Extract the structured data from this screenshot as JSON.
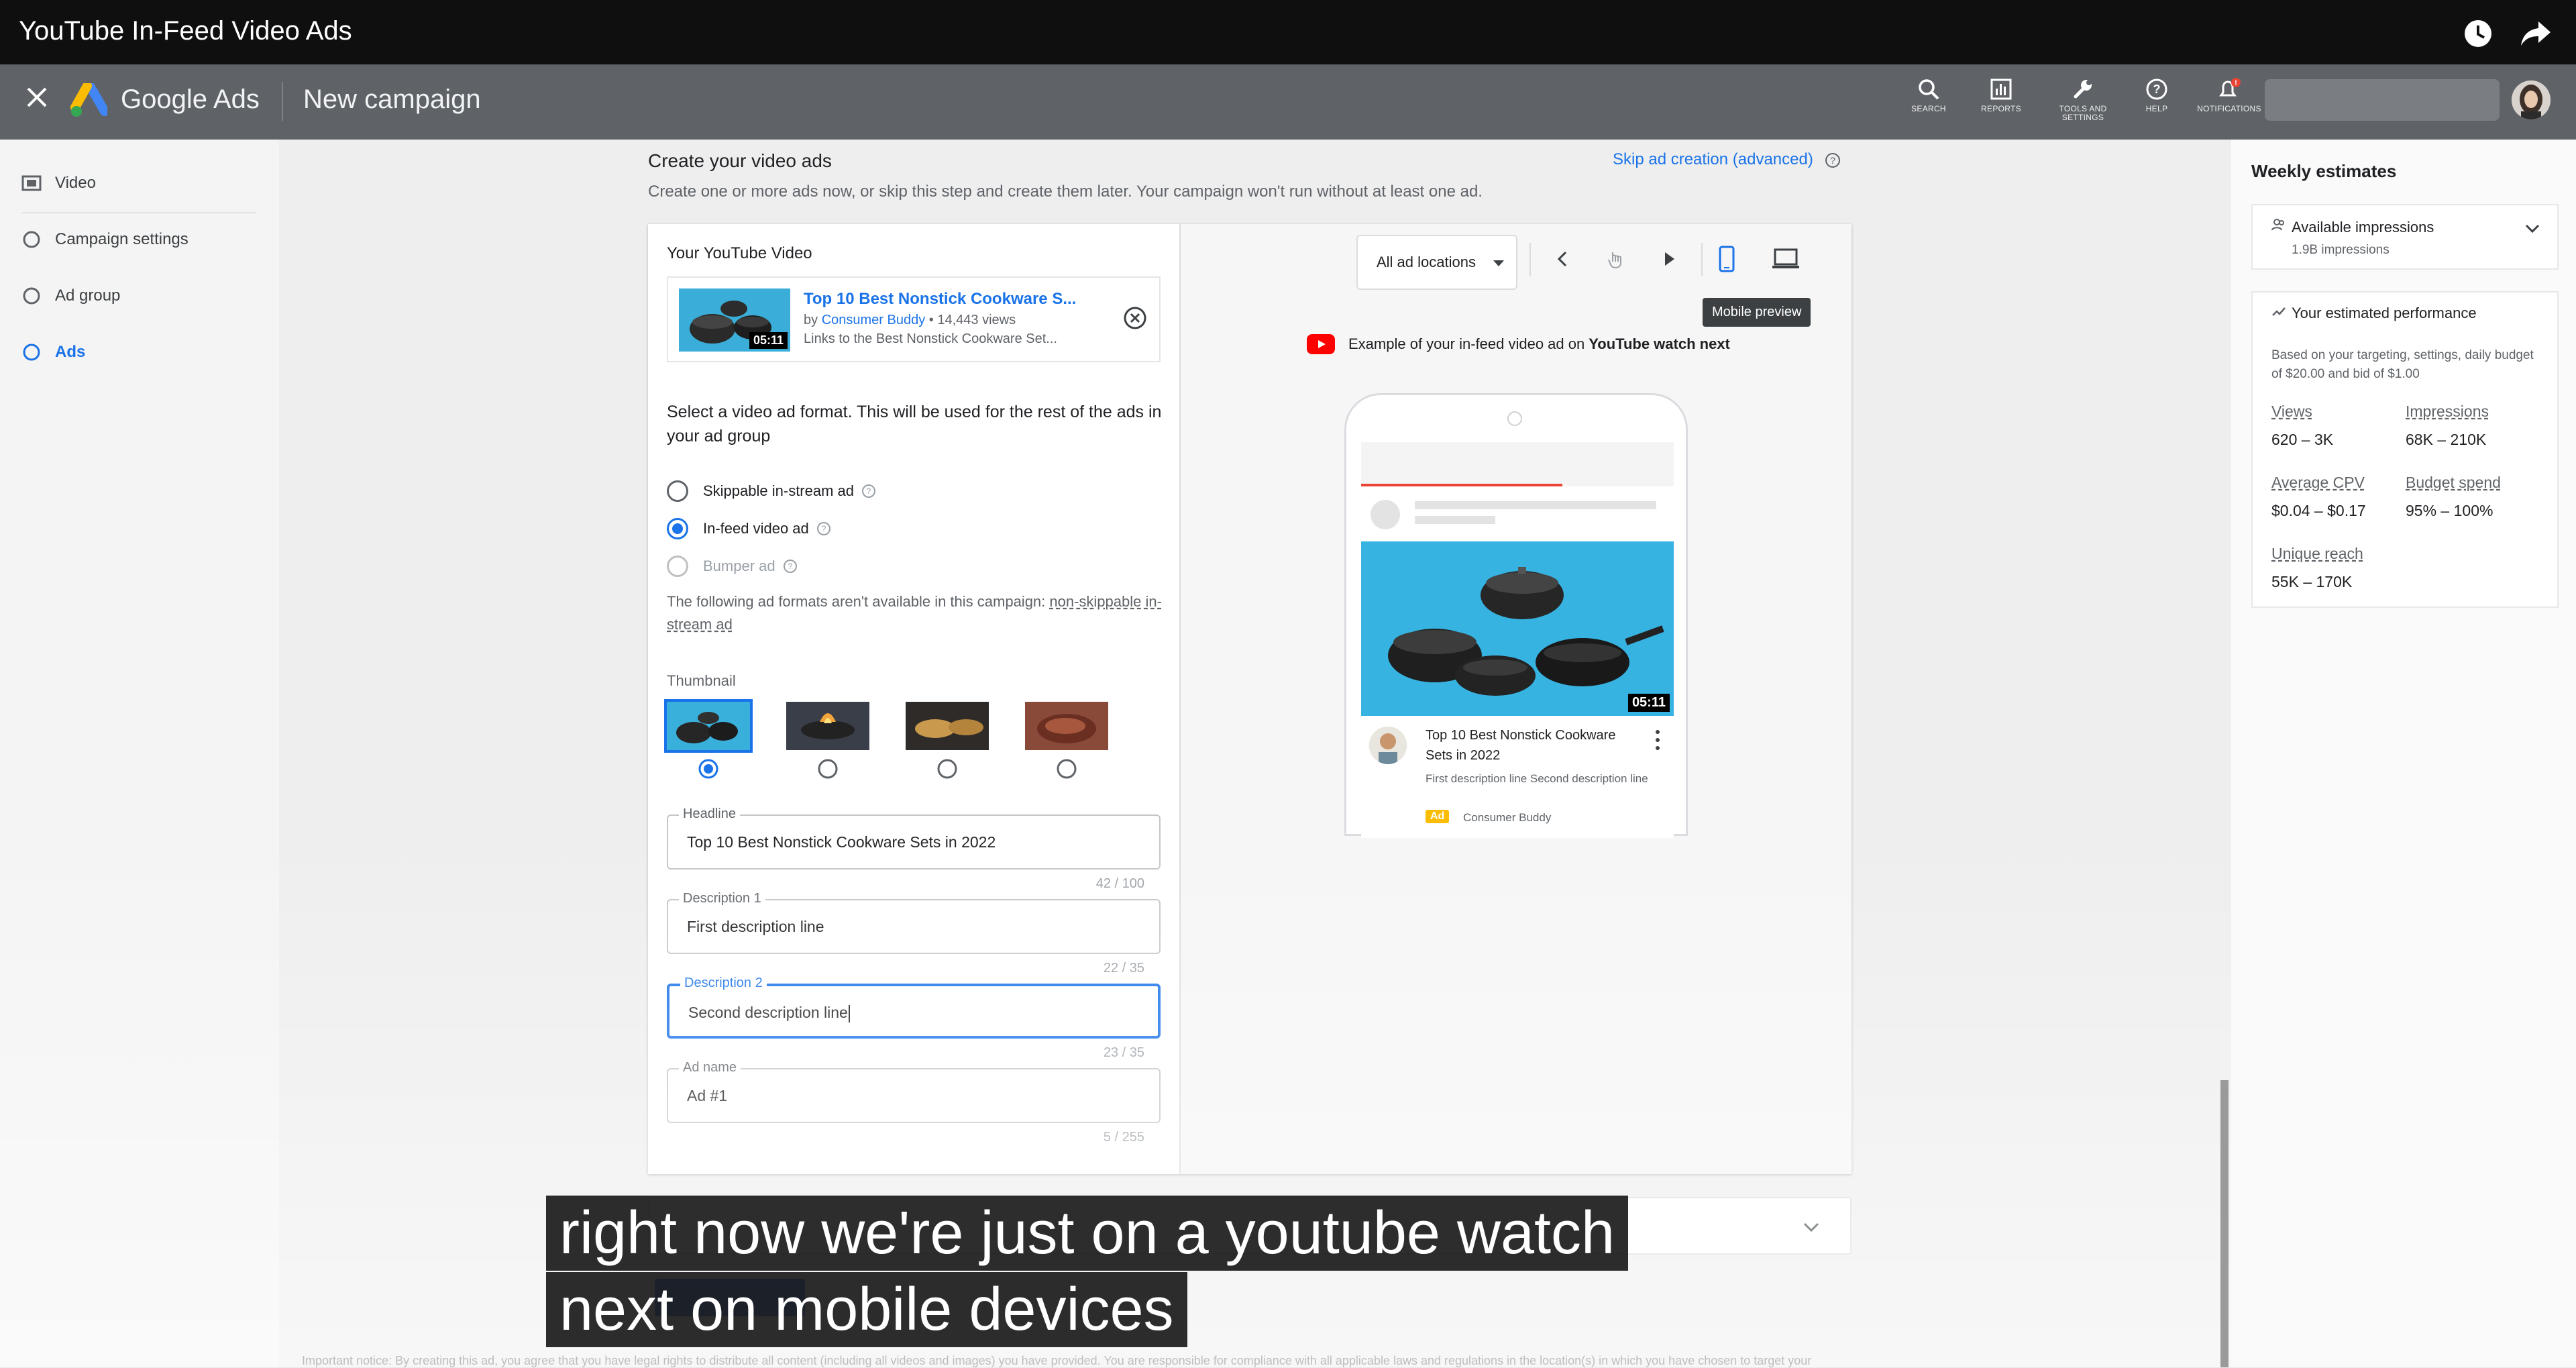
{
  "player": {
    "title": "YouTube In-Feed Video Ads"
  },
  "header": {
    "brand": "Google Ads",
    "page_title": "New campaign",
    "icons": [
      {
        "name": "search-icon",
        "label": "SEARCH"
      },
      {
        "name": "reports-icon",
        "label": "REPORTS"
      },
      {
        "name": "tools-icon",
        "label": "TOOLS AND SETTINGS"
      },
      {
        "name": "help-icon",
        "label": "HELP"
      },
      {
        "name": "notifications-icon",
        "label": "NOTIFICATIONS",
        "badge": "!"
      }
    ]
  },
  "sidebar": {
    "items": [
      {
        "label": "Video",
        "icon": "video-icon",
        "active": false
      },
      {
        "label": "Campaign settings",
        "icon": "circle-icon",
        "active": false
      },
      {
        "label": "Ad group",
        "icon": "circle-icon",
        "active": false
      },
      {
        "label": "Ads",
        "icon": "circle-icon",
        "active": true
      }
    ]
  },
  "main": {
    "section_title": "Create your video ads",
    "section_sub": "Create one or more ads now, or skip this step and create them later. Your campaign won't run without at least one ad.",
    "skip_link": "Skip ad creation (advanced)",
    "video": {
      "label": "Your YouTube Video",
      "title": "Top 10 Best Nonstick Cookware S...",
      "by": "by",
      "channel": "Consumer Buddy",
      "views": " • 14,443 views",
      "link": "Links to the Best Nonstick Cookware Set...",
      "duration": "05:11"
    },
    "format_question": "Select a video ad format. This will be used for the rest of the ads in your ad group",
    "formats": [
      {
        "label": "Skippable in-stream ad",
        "state": "off"
      },
      {
        "label": "In-feed video ad",
        "state": "on"
      },
      {
        "label": "Bumper ad",
        "state": "disabled"
      }
    ],
    "notice_text": "The following ad formats aren't available in this campaign: ",
    "notice_link": "non-skippable in-stream ad",
    "thumbnail_label": "Thumbnail",
    "thumbnail_selected": 0,
    "fields": [
      {
        "label": "Headline",
        "value": "Top 10 Best Nonstick Cookware Sets in 2022",
        "counter": "42 / 100",
        "focused": false
      },
      {
        "label": "Description 1",
        "value": "First description line",
        "counter": "22 / 35",
        "focused": false
      },
      {
        "label": "Description 2",
        "value": "Second description line",
        "counter": "23 / 35",
        "focused": true
      },
      {
        "label": "Ad name",
        "value": "Ad #1",
        "counter": "5 / 255",
        "focused": false
      }
    ]
  },
  "preview": {
    "location_select": "All ad locations",
    "tooltip": "Mobile preview",
    "example_text": "Example of your in-feed video ad on",
    "example_bold": "YouTube watch next",
    "ad": {
      "title": "Top 10 Best Nonstick Cookware Sets in 2022",
      "description": "First description line Second description line",
      "badge": "Ad",
      "channel": "Consumer Buddy",
      "duration": "05:11"
    }
  },
  "legal_text": "Important notice: By creating this ad, you agree that you have legal rights to distribute all content (including all videos and images) you have provided. You are responsible for compliance with all applicable laws and regulations in the location(s) in which you have chosen to target your",
  "estimates": {
    "title": "Weekly estimates",
    "impressions_label": "Available impressions",
    "impressions_value": "1.9B impressions",
    "performance_label": "Your estimated performance",
    "performance_note": "Based on your targeting, settings, daily budget of $20.00 and bid of $1.00",
    "metrics": [
      {
        "label": "Views",
        "value": "620 – 3K"
      },
      {
        "label": "Impressions",
        "value": "68K – 210K"
      },
      {
        "label": "Average CPV",
        "value": "$0.04 – $0.17"
      },
      {
        "label": "Budget spend",
        "value": "95% – 100%"
      },
      {
        "label": "Unique reach",
        "value": "55K – 170K"
      }
    ]
  },
  "caption": {
    "line1": "right now we're just on a youtube watch",
    "line2": "next on mobile devices"
  },
  "colors": {
    "accent": "#1a73e8",
    "header_bg": "#5f6368",
    "youtube_red": "#ff0000",
    "ad_badge": "#fbbc04"
  }
}
